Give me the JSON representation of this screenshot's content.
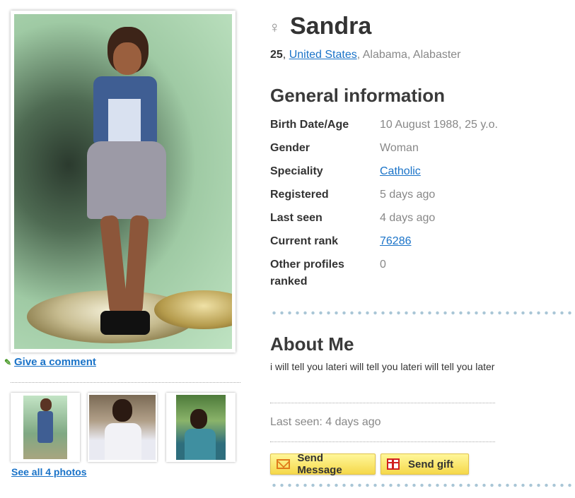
{
  "profile": {
    "name": "Sandra",
    "age": "25",
    "country": "United States",
    "location_rest": ", Alabama, Alabaster"
  },
  "general": {
    "title": "General information",
    "rows": [
      {
        "label": "Birth Date/Age",
        "value": "10 August 1988, 25 y.o.",
        "link": false
      },
      {
        "label": "Gender",
        "value": "Woman",
        "link": false
      },
      {
        "label": "Speciality",
        "value": "Catholic",
        "link": true
      },
      {
        "label": "Registered",
        "value": "5 days ago",
        "link": false
      },
      {
        "label": "Last seen",
        "value": "4 days ago",
        "link": false
      },
      {
        "label": "Current rank",
        "value": "76286",
        "link": true
      },
      {
        "label": "Other profiles ranked",
        "value": "0",
        "link": false
      }
    ]
  },
  "about": {
    "title": "About Me",
    "text": "i will tell you lateri will tell you lateri will tell you later",
    "last_seen": "Last seen: 4 days ago"
  },
  "actions": {
    "send_message": "Send Message",
    "send_gift": "Send gift"
  },
  "photos": {
    "give_comment": "Give a comment",
    "see_all": "See all 4 photos"
  },
  "icons": {
    "gender": "female-symbol-icon",
    "comment": "pencil-icon",
    "message": "envelope-icon",
    "gift": "gift-icon"
  },
  "colors": {
    "link": "#1a73c8",
    "button": "#f5d84a",
    "dots": "#a9c6d6"
  }
}
